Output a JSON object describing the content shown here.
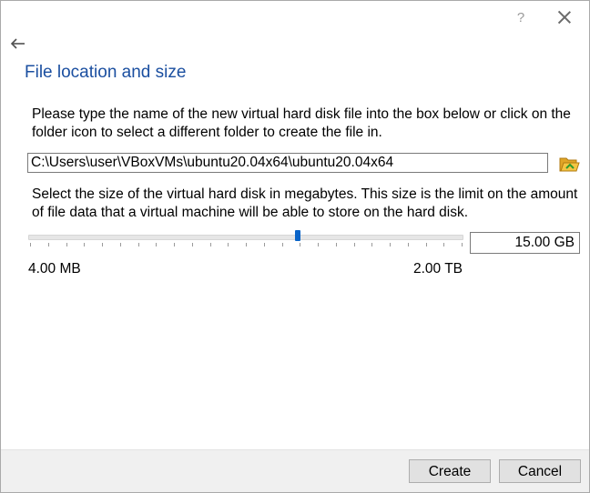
{
  "titlebar": {
    "help_label": "?"
  },
  "page": {
    "title": "File location and size",
    "instructions_location": "Please type the name of the new virtual hard disk file into the box below or click on the folder icon to select a different folder to create the file in.",
    "instructions_size": "Select the size of the virtual hard disk in megabytes. This size is the limit on the amount of file data that a virtual machine will be able to store on the hard disk."
  },
  "file": {
    "path_value": "C:\\Users\\user\\VBoxVMs\\ubuntu20.04x64\\ubuntu20.04x64"
  },
  "size": {
    "value": "15.00 GB",
    "slider_position": 0.62,
    "slider_tick_count": 25,
    "min_label": "4.00 MB",
    "max_label": "2.00 TB"
  },
  "buttons": {
    "create": "Create",
    "cancel": "Cancel"
  },
  "icons": {
    "back": "back-arrow-icon",
    "folder": "folder-open-icon",
    "close": "close-icon",
    "help": "help-icon"
  },
  "colors": {
    "heading": "#1b4fa0",
    "slider_thumb": "#0a64c8",
    "folder": "#e0a526"
  }
}
